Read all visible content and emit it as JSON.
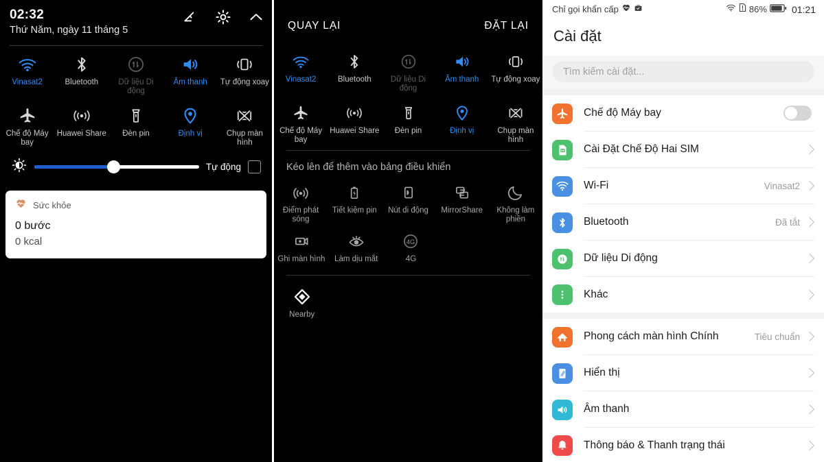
{
  "panel1": {
    "status": {
      "time": "02:32",
      "date": "Thứ Năm, ngày 11 tháng 5"
    },
    "header_actions": [
      {
        "name": "edit-icon",
        "label": "Chỉnh sửa"
      },
      {
        "name": "settings-gear-icon",
        "label": "Cài đặt"
      },
      {
        "name": "chevron-up-icon",
        "label": "Thu gọn"
      }
    ],
    "quick_settings": [
      {
        "icon": "wifi-icon",
        "label": "Vinasat2",
        "state": "on"
      },
      {
        "icon": "bluetooth-icon",
        "label": "Bluetooth",
        "state": "off"
      },
      {
        "icon": "mobile-data-icon",
        "label": "Dữ liệu Di động",
        "state": "disabled"
      },
      {
        "icon": "sound-icon",
        "label": "Âm thanh",
        "state": "on"
      },
      {
        "icon": "auto-rotate-icon",
        "label": "Tự động xoay",
        "state": "off"
      },
      {
        "icon": "airplane-icon",
        "label": "Chế độ Máy bay",
        "state": "off"
      },
      {
        "icon": "huawei-share-icon",
        "label": "Huawei Share",
        "state": "off"
      },
      {
        "icon": "flashlight-icon",
        "label": "Đèn pin",
        "state": "off"
      },
      {
        "icon": "location-icon",
        "label": "Định vị",
        "state": "on"
      },
      {
        "icon": "screenshot-icon",
        "label": "Chụp màn hình",
        "state": "off"
      }
    ],
    "brightness": {
      "icon": "brightness-icon",
      "value_percent": 48,
      "auto_label": "Tự động",
      "auto_checked": false
    },
    "notification": {
      "icon": "health-heart-icon",
      "app": "Sức khỏe",
      "line1": "0 bước",
      "line2": "0 kcal"
    }
  },
  "panel2": {
    "back_label": "QUAY LẠI",
    "reset_label": "ĐẶT LẠI",
    "active_tiles": [
      {
        "icon": "wifi-icon",
        "label": "Vinasat2",
        "state": "on"
      },
      {
        "icon": "bluetooth-icon",
        "label": "Bluetooth",
        "state": "off"
      },
      {
        "icon": "mobile-data-icon",
        "label": "Dữ liệu Di động",
        "state": "disabled"
      },
      {
        "icon": "sound-icon",
        "label": "Âm thanh",
        "state": "on"
      },
      {
        "icon": "auto-rotate-icon",
        "label": "Tự động xoay",
        "state": "off"
      },
      {
        "icon": "airplane-icon",
        "label": "Chế độ Máy bay",
        "state": "off"
      },
      {
        "icon": "huawei-share-icon",
        "label": "Huawei Share",
        "state": "off"
      },
      {
        "icon": "flashlight-icon",
        "label": "Đèn pin",
        "state": "off"
      },
      {
        "icon": "location-icon",
        "label": "Định vị",
        "state": "on"
      },
      {
        "icon": "screenshot-icon",
        "label": "Chụp màn hình",
        "state": "off"
      }
    ],
    "hint": "Kéo lên để thêm vào bảng điều khiển",
    "available_tiles": [
      {
        "icon": "hotspot-icon",
        "label": "Điểm phát sóng"
      },
      {
        "icon": "battery-saver-icon",
        "label": "Tiết kiệm pin"
      },
      {
        "icon": "floating-button-icon",
        "label": "Nút di động"
      },
      {
        "icon": "mirrorshare-icon",
        "label": "MirrorShare"
      },
      {
        "icon": "do-not-disturb-icon",
        "label": "Không làm phiền"
      },
      {
        "icon": "screen-record-icon",
        "label": "Ghi màn hình"
      },
      {
        "icon": "eye-comfort-icon",
        "label": "Làm dịu mắt"
      },
      {
        "icon": "4g-icon",
        "label": "4G"
      }
    ],
    "extra_tiles": [
      {
        "icon": "nearby-icon",
        "label": "Nearby"
      }
    ]
  },
  "panel3": {
    "status_bar": {
      "carrier": "Chỉ gọi khẩn cấp",
      "left_icons": [
        "health-heart-icon",
        "work-profile-icon"
      ],
      "right_icons": [
        "wifi-icon",
        "sim-alert-icon",
        "battery-icon"
      ],
      "battery": "86%",
      "clock": "01:21"
    },
    "title": "Cài đặt",
    "search_placeholder": "Tìm kiếm cài đặt...",
    "groups": [
      {
        "rows": [
          {
            "icon": "airplane-icon",
            "icon_color": "#f0722e",
            "label": "Chế độ Máy bay",
            "control": "toggle",
            "toggle_on": false
          },
          {
            "icon": "dual-sim-icon",
            "icon_color": "#4ec16e",
            "label": "Cài Đặt Chế Độ Hai SIM",
            "control": "chevron",
            "value": ""
          },
          {
            "icon": "wifi-icon",
            "icon_color": "#4a90e2",
            "label": "Wi-Fi",
            "control": "chevron",
            "value": "Vinasat2"
          },
          {
            "icon": "bluetooth-icon",
            "icon_color": "#4a90e2",
            "label": "Bluetooth",
            "control": "chevron",
            "value": "Đã tắt"
          },
          {
            "icon": "mobile-data-icon",
            "icon_color": "#4ec16e",
            "label": "Dữ liệu Di động",
            "control": "chevron",
            "value": ""
          },
          {
            "icon": "more-icon",
            "icon_color": "#4ec16e",
            "label": "Khác",
            "control": "chevron",
            "value": ""
          }
        ]
      },
      {
        "rows": [
          {
            "icon": "home-screen-icon",
            "icon_color": "#f0722e",
            "label": "Phong cách màn hình Chính",
            "control": "chevron",
            "value": "Tiêu chuẩn"
          },
          {
            "icon": "display-icon",
            "icon_color": "#4a90e2",
            "label": "Hiển thị",
            "control": "chevron",
            "value": ""
          },
          {
            "icon": "sound-icon",
            "icon_color": "#2fb9d6",
            "label": "Âm thanh",
            "control": "chevron",
            "value": ""
          },
          {
            "icon": "notifications-bell-icon",
            "icon_color": "#ef4a4a",
            "label": "Thông báo & Thanh trạng thái",
            "control": "chevron",
            "value": ""
          }
        ]
      }
    ]
  },
  "colors": {
    "accent_blue": "#2f8cf5",
    "shade_bg": "#000000",
    "settings_bg": "#ffffff",
    "muted_text": "#9b9b9b"
  }
}
